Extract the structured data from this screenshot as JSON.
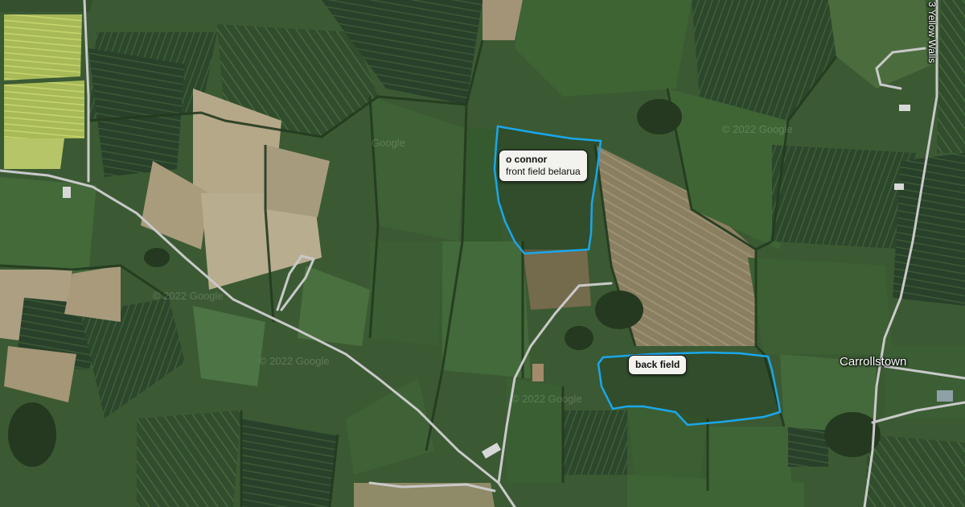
{
  "map": {
    "fields": [
      {
        "owner": "o connor",
        "name": "front field belarua"
      },
      {
        "name": "back field"
      }
    ],
    "places": {
      "town": "Carrollstown",
      "road": "3 Yellow Walls"
    },
    "watermarks": [
      "Google",
      "© 2022 Google",
      "© 2022 Google",
      "© 2022 Google",
      "© 2022 Google"
    ],
    "colors": {
      "field_outline": "#1aa7ec",
      "label_bg": "#f2f2ee",
      "road": "#c9c9c9"
    }
  }
}
